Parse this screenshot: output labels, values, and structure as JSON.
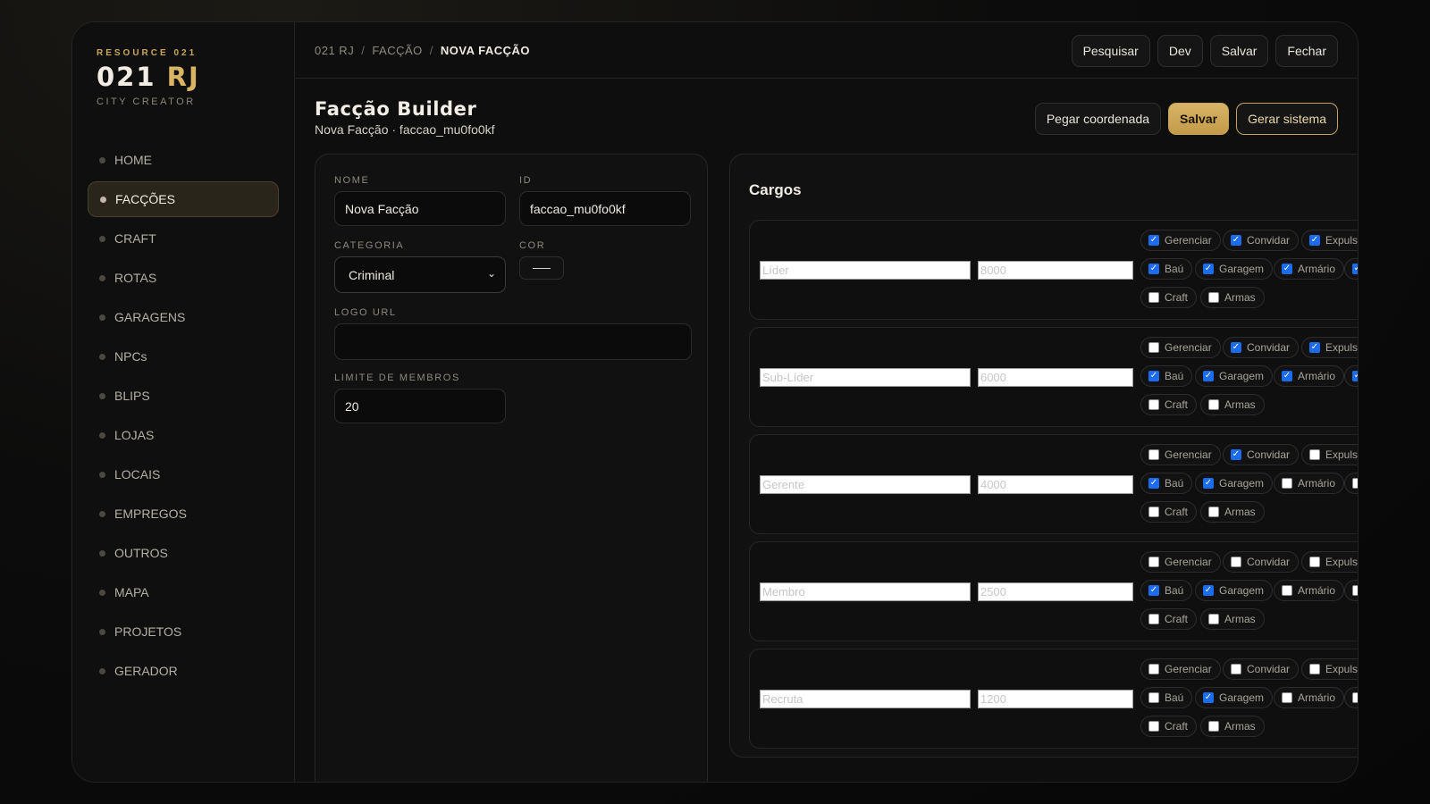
{
  "brand": {
    "kicker": "RESOURCE 021",
    "title_part1": "021",
    "title_part2": "RJ",
    "subtitle": "CITY CREATOR"
  },
  "sidebar": {
    "items": [
      {
        "label": "HOME"
      },
      {
        "label": "FACÇÕES"
      },
      {
        "label": "CRAFT"
      },
      {
        "label": "ROTAS"
      },
      {
        "label": "GARAGENS"
      },
      {
        "label": "NPCs"
      },
      {
        "label": "BLIPS"
      },
      {
        "label": "LOJAS"
      },
      {
        "label": "LOCAIS"
      },
      {
        "label": "EMPREGOS"
      },
      {
        "label": "OUTROS"
      },
      {
        "label": "MAPA"
      },
      {
        "label": "PROJETOS"
      },
      {
        "label": "GERADOR"
      }
    ],
    "active_index": 1
  },
  "breadcrumb": {
    "root": "021 RJ",
    "section": "FACÇÃO",
    "current": "NOVA FACÇÃO",
    "separator": "/"
  },
  "top_actions": {
    "search": "Pesquisar",
    "dev": "Dev",
    "save": "Salvar",
    "close": "Fechar"
  },
  "page": {
    "title": "Facção Builder",
    "subtitle": "Nova Facção · faccao_mu0fo0kf"
  },
  "head_actions": {
    "coords": "Pegar coordenada",
    "save": "Salvar",
    "generate": "Gerar sistema"
  },
  "form": {
    "name_label": "NOME",
    "name_value": "Nova Facção",
    "id_label": "ID",
    "id_value": "faccao_mu0fo0kf",
    "category_label": "CATEGORIA",
    "category_value": "Criminal",
    "color_label": "COR",
    "logo_label": "LOGO URL",
    "logo_value": "",
    "limit_label": "LIMITE DE MEMBROS",
    "limit_value": "20"
  },
  "cargos": {
    "title": "Cargos",
    "roles": [
      {
        "name": "Líder",
        "salary": "8000",
        "perms": {
          "gerenciar": true,
          "convidar": true,
          "expulsar": true,
          "bau": true,
          "garagem": true,
          "armario": true,
          "craft": false,
          "armas": false
        }
      },
      {
        "name": "Sub-Líder",
        "salary": "6000",
        "perms": {
          "gerenciar": false,
          "convidar": true,
          "expulsar": true,
          "bau": true,
          "garagem": true,
          "armario": true,
          "craft": false,
          "armas": false
        }
      },
      {
        "name": "Gerente",
        "salary": "4000",
        "perms": {
          "gerenciar": false,
          "convidar": true,
          "expulsar": false,
          "bau": true,
          "garagem": true,
          "armario": false,
          "craft": false,
          "armas": false
        }
      },
      {
        "name": "Membro",
        "salary": "2500",
        "perms": {
          "gerenciar": false,
          "convidar": false,
          "expulsar": false,
          "bau": true,
          "garagem": true,
          "armario": false,
          "craft": false,
          "armas": false
        }
      },
      {
        "name": "Recruta",
        "salary": "1200",
        "perms": {
          "gerenciar": false,
          "convidar": false,
          "expulsar": false,
          "bau": false,
          "garagem": true,
          "armario": false,
          "craft": false,
          "armas": false
        }
      }
    ],
    "perm_labels": {
      "gerenciar": "Gerenciar",
      "convidar": "Convidar",
      "expulsar": "Expulsa",
      "bau": "Baú",
      "garagem": "Garagem",
      "armario": "Armário",
      "craft": "Craft",
      "armas": "Armas"
    }
  },
  "colors": {
    "accent": "#d4af62",
    "checkbox": "#1b6cf2",
    "panel": "#111111",
    "background": "#0c0c0c"
  }
}
